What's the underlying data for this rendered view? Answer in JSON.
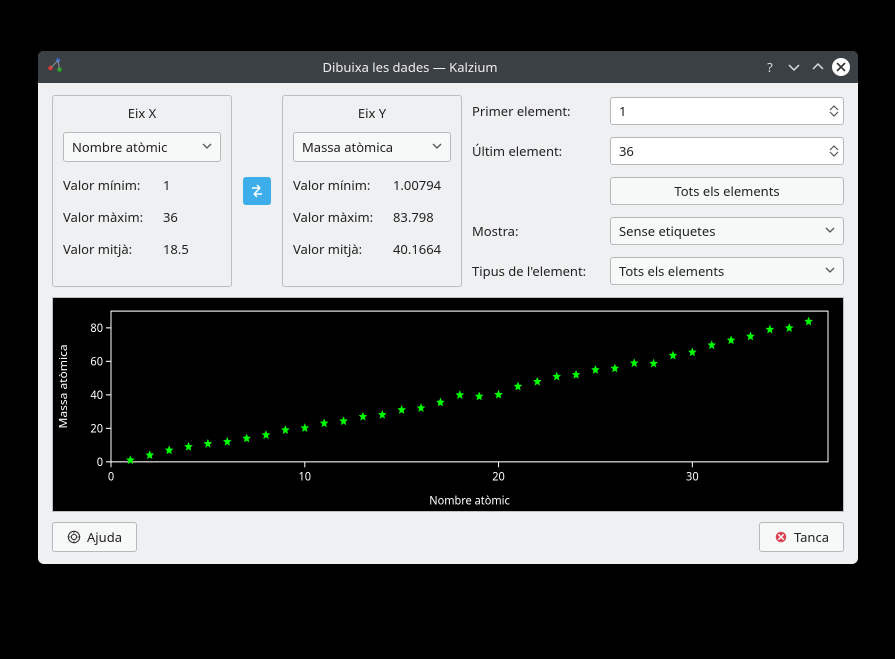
{
  "window": {
    "title": "Dibuixa les dades — Kalzium"
  },
  "axis_x": {
    "title": "Eix X",
    "select": "Nombre atòmic",
    "min_label": "Valor mínim:",
    "min": "1",
    "max_label": "Valor màxim:",
    "max": "36",
    "avg_label": "Valor mitjà:",
    "avg": "18.5"
  },
  "axis_y": {
    "title": "Eix Y",
    "select": "Massa atòmica",
    "min_label": "Valor mínim:",
    "min": "1.00794",
    "max_label": "Valor màxim:",
    "max": "83.798",
    "avg_label": "Valor mitjà:",
    "avg": "40.1664"
  },
  "controls": {
    "first_label": "Primer element:",
    "first": "1",
    "last_label": "Últim element:",
    "last": "36",
    "all_btn": "Tots els elements",
    "show_label": "Mostra:",
    "show": "Sense etiquetes",
    "type_label": "Tipus de l'element:",
    "type": "Tots els elements"
  },
  "footer": {
    "help": "Ajuda",
    "close": "Tanca"
  },
  "chart_data": {
    "type": "scatter",
    "xlabel": "Nombre atòmic",
    "ylabel": "Massa atòmica",
    "xlim": [
      0,
      37
    ],
    "ylim": [
      0,
      90
    ],
    "xticks": [
      0,
      10,
      20,
      30
    ],
    "yticks": [
      0,
      20,
      40,
      60,
      80
    ],
    "x": [
      1,
      2,
      3,
      4,
      5,
      6,
      7,
      8,
      9,
      10,
      11,
      12,
      13,
      14,
      15,
      16,
      17,
      18,
      19,
      20,
      21,
      22,
      23,
      24,
      25,
      26,
      27,
      28,
      29,
      30,
      31,
      32,
      33,
      34,
      35,
      36
    ],
    "y": [
      1.0,
      4.0,
      6.9,
      9.0,
      10.8,
      12.0,
      14.0,
      16.0,
      19.0,
      20.2,
      23.0,
      24.3,
      27.0,
      28.1,
      31.0,
      32.1,
      35.5,
      39.9,
      39.1,
      40.1,
      45.0,
      47.9,
      50.9,
      52.0,
      54.9,
      55.8,
      58.9,
      58.7,
      63.5,
      65.4,
      69.7,
      72.6,
      74.9,
      79.0,
      79.9,
      83.8
    ],
    "marker_color": "#00ff00"
  }
}
